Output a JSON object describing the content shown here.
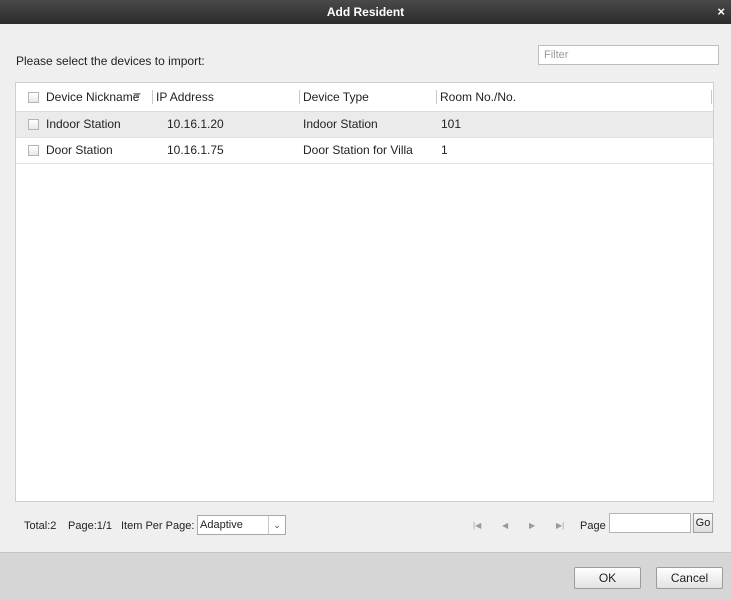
{
  "dialog": {
    "title": "Add Resident",
    "close_glyph": "×"
  },
  "prompt": "Please select the devices to import:",
  "filter": {
    "placeholder": "Filter",
    "value": ""
  },
  "table": {
    "columns": [
      "Device Nickname",
      "IP Address",
      "Device Type",
      "Room No./No."
    ],
    "rows": [
      {
        "nickname": "Indoor Station",
        "ip": "10.16.1.20",
        "type": "Indoor Station",
        "room": "101",
        "checked": false
      },
      {
        "nickname": "Door Station",
        "ip": "10.16.1.75",
        "type": "Door Station for Villa",
        "room": "1",
        "checked": false
      }
    ]
  },
  "pager": {
    "total": "Total:2",
    "page_info": "Page:1/1",
    "per_page_label": "Item Per Page:",
    "per_page_value": "Adaptive",
    "page_label": "Page",
    "go_label": "Go",
    "icons": [
      "first-page-icon",
      "prev-page-icon",
      "next-page-icon",
      "last-page-icon"
    ]
  },
  "buttons": {
    "ok": "OK",
    "cancel": "Cancel"
  },
  "colors": {
    "titlebar": "#3a3a3a",
    "selected_row": "#ebebeb",
    "footer": "#d6d6d6"
  }
}
